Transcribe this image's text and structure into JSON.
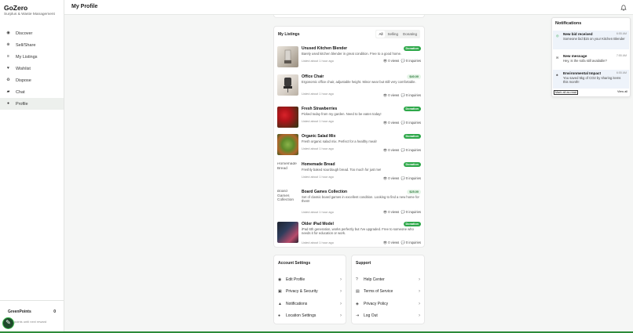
{
  "app": {
    "name": "GoZero",
    "tagline": "Surplus & Waste Management"
  },
  "sidebar": {
    "items": [
      {
        "label": "Discover",
        "icon": "compass-icon"
      },
      {
        "label": "Sell/Share",
        "icon": "plus-circle-icon"
      },
      {
        "label": "My Listings",
        "icon": "list-icon"
      },
      {
        "label": "Wishlist",
        "icon": "heart-icon"
      },
      {
        "label": "Dispose",
        "icon": "recycle-icon"
      },
      {
        "label": "Chat",
        "icon": "chat-icon"
      },
      {
        "label": "Profile",
        "icon": "user-icon",
        "active": true
      }
    ]
  },
  "green_points": {
    "label": "GreenPoints",
    "value": "0",
    "hint": "points until next reward"
  },
  "header": {
    "title": "My Profile"
  },
  "listings": {
    "title": "My Listings",
    "tabs": [
      "All",
      "Selling",
      "Donating"
    ],
    "active_tab": "All",
    "items": [
      {
        "title": "Unused Kitchen Blender",
        "badge": "Donation",
        "desc": "Barely used kitchen blender in great condition. Free to a good home.",
        "meta": "Listed about 1 hour ago",
        "views": "0 views",
        "inquiries": "0 inquiries"
      },
      {
        "title": "Office Chair",
        "badge": "$40.00",
        "desc": "Ergonomic office chair, adjustable height. Minor wear but still very comfortable.",
        "meta": "Listed about 1 hour ago",
        "views": "0 views",
        "inquiries": "0 inquiries"
      },
      {
        "title": "Fresh Strawberries",
        "badge": "Donation",
        "desc": "Picked today from my garden. Need to be eaten today!",
        "meta": "Listed about 1 hour ago",
        "views": "0 views",
        "inquiries": "0 inquiries"
      },
      {
        "title": "Organic Salad Mix",
        "badge": "Donation",
        "desc": "Fresh organic salad mix. Perfect for a healthy meal!",
        "meta": "Listed about 1 hour ago",
        "views": "0 views",
        "inquiries": "0 inquiries"
      },
      {
        "title": "Homemade Bread",
        "badge": "Donation",
        "desc": "Freshly baked sourdough bread. Too much for just me!",
        "meta": "Listed about 1 hour ago",
        "views": "0 views",
        "inquiries": "0 inquiries",
        "alt": "Homemade Bread"
      },
      {
        "title": "Board Games Collection",
        "badge": "$25.00",
        "desc": "Set of classic board games in excellent condition. Looking to find a new home for them!",
        "meta": "Listed about 1 hour ago",
        "views": "0 views",
        "inquiries": "0 inquiries",
        "alt": "Board Games Collection"
      },
      {
        "title": "Older iPad Model",
        "badge": "Donation",
        "desc": "iPad 6th generation, works perfectly but I've upgraded. Free to someone who needs it for education or work.",
        "meta": "Listed about 1 hour ago",
        "views": "0 views",
        "inquiries": "0 inquiries"
      }
    ]
  },
  "account_settings": {
    "title": "Account Settings",
    "items": [
      {
        "label": "Edit Profile",
        "icon": "user-circle-icon"
      },
      {
        "label": "Privacy & Security",
        "icon": "lock-icon"
      },
      {
        "label": "Notifications",
        "icon": "bell-icon"
      },
      {
        "label": "Location Settings",
        "icon": "location-pin-icon"
      }
    ]
  },
  "support": {
    "title": "Support",
    "items": [
      {
        "label": "Help Center",
        "icon": "help-circle-icon"
      },
      {
        "label": "Terms of Service",
        "icon": "document-icon"
      },
      {
        "label": "Privacy Policy",
        "icon": "shield-icon"
      },
      {
        "label": "Log Out",
        "icon": "logout-icon"
      }
    ]
  },
  "notifications": {
    "title": "Notifications",
    "items": [
      {
        "title": "New bid received",
        "time": "6:55 AM",
        "body": "Someone bid $15 on your Kitchen Blender",
        "unread": true
      },
      {
        "title": "New message",
        "time": "7:55 AM",
        "body": "Hey, is the sofa still available?",
        "unread": false
      },
      {
        "title": "Environmental Impact",
        "time": "6:55 AM",
        "body": "You saved 5kg of CO2 by sharing items this month!",
        "unread": true
      }
    ],
    "mark_all": "Mark all as read",
    "view_all": "View all"
  },
  "colors": {
    "brand_green": "#2ea84a",
    "dark_green": "#1f4a2b"
  }
}
